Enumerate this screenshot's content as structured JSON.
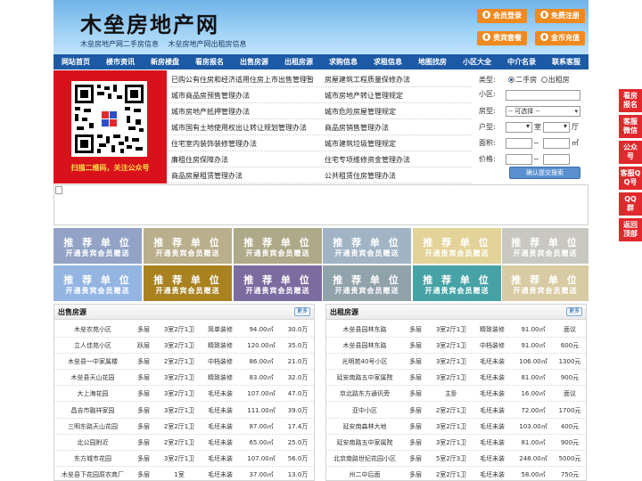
{
  "header": {
    "logo": "木垒房地产网",
    "sub1": "木垒房地产网二手房信息",
    "sub2": "木垒房地产网出租房信息",
    "buttons": [
      "会员登录",
      "免费注册",
      "贵宾套餐",
      "金币充值"
    ]
  },
  "nav": [
    "网站首页",
    "楼市资讯",
    "新房楼盘",
    "看房报名",
    "出售房源",
    "出租房源",
    "求购信息",
    "求租信息",
    "地图找房",
    "小区大全",
    "中介名录",
    "联系客服"
  ],
  "qr": {
    "caption": "扫描二维码，关注公众号"
  },
  "links": {
    "left": [
      "已购公有住房和经济适用住房上市出售管理暂",
      "城市商品房预售管理办法",
      "城市房地产抵押管理办法",
      "城市国有土地使用权出让转让规划管理办法",
      "住宅室内装饰装修管理办法",
      "廉租住房保障办法",
      "商品房屋租赁管理办法"
    ],
    "right": [
      "房屋建筑工程质量保修办法",
      "城市房地产转让管理规定",
      "城市危险房屋管理规定",
      "商品房销售管理办法",
      "城市建筑垃圾管理规定",
      "住宅专项维修资金管理办法",
      "公共租赁住房管理办法"
    ]
  },
  "search": {
    "type_label": "类型:",
    "opt1": "二手房",
    "opt2": "出租房",
    "community_label": "小区:",
    "type2_label": "房型:",
    "select_placeholder": "-- 可选择 --",
    "layout_label": "户型:",
    "room": "室",
    "hall": "厅",
    "area_label": "面积:",
    "area_unit": "㎡",
    "price_label": "价格:",
    "tilde": "~",
    "submit": "确认提交搜索"
  },
  "ads": {
    "title": "推 荐 单 位",
    "sub": "开通贵宾会员赠送",
    "colors": [
      "#8e9fc4",
      "#b6ab86",
      "#aaa582",
      "#9db1c4",
      "#e2d194",
      "#c7c5be",
      "#8fb2e0",
      "#a57b14",
      "#75649a",
      "#8b9ea6",
      "#3d9ea1",
      "#d6c9a0"
    ]
  },
  "sale": {
    "title": "出售房源",
    "more": "更多",
    "rows": [
      [
        "木垒农苑小区",
        "多层",
        "3室2厅1卫",
        "简单装修",
        "94.00㎡",
        "30.0万"
      ],
      [
        "立人佳苑小区",
        "跃层",
        "3室2厅1卫",
        "精致装修",
        "120.00㎡",
        "35.0万"
      ],
      [
        "木垒县一中家属楼",
        "多层",
        "2室2厅1卫",
        "中档装修",
        "86.00㎡",
        "21.0万"
      ],
      [
        "木垒县天山花园",
        "多层",
        "3室2厅1卫",
        "精致装修",
        "83.00㎡",
        "32.0万"
      ],
      [
        "大上海花园",
        "多层",
        "3室2厅1卫",
        "毛坯未装",
        "107.00㎡",
        "47.0万"
      ],
      [
        "昌吉市融祥家园",
        "多层",
        "3室2厅1卫",
        "毛坯未装",
        "111.00㎡",
        "39.0万"
      ],
      [
        "三明东路天山花园",
        "多层",
        "2室2厅1卫",
        "毛坯未装",
        "87.00㎡",
        "17.4万"
      ],
      [
        "北公园附近",
        "多层",
        "2室2厅1卫",
        "毛坯未装",
        "65.00㎡",
        "25.0万"
      ],
      [
        "东方城市花园",
        "多层",
        "3室2厅1卫",
        "毛坯未装",
        "107.00㎡",
        "56.0万"
      ],
      [
        "木垒县下花园原农商厂",
        "多层",
        "1室",
        "毛坯未装",
        "37.00㎡",
        "13.0万"
      ]
    ]
  },
  "rent": {
    "title": "出租房源",
    "more": "更多",
    "rows": [
      [
        "木垒县园林东路",
        "多层",
        "3室2厅1卫",
        "精致装修",
        "91.00㎡",
        "面议"
      ],
      [
        "木垒县园林东路",
        "多层",
        "3室2厅1卫",
        "中档装修",
        "91.00㎡",
        "600元"
      ],
      [
        "光明苑40号小区",
        "多层",
        "3室2厅1卫",
        "毛坯未装",
        "106.00㎡",
        "1300元"
      ],
      [
        "延安南路五中家属院",
        "多层",
        "3室2厅1卫",
        "毛坯未装",
        "81.00㎡",
        "900元"
      ],
      [
        "京北路东方通讯旁",
        "多层",
        "主卧",
        "毛坯未装",
        "16.00㎡",
        "面议"
      ],
      [
        "亚中小区",
        "多层",
        "2室2厅1卫",
        "毛坯未装",
        "72.00㎡",
        "1700元"
      ],
      [
        "延安南森林大地",
        "多层",
        "3室2厅1卫",
        "毛坯未装",
        "103.00㎡",
        "400元"
      ],
      [
        "延安南路五中家属院",
        "多层",
        "3室2厅1卫",
        "毛坯未装",
        "81.00㎡",
        "900元"
      ],
      [
        "北京南路世纪花园小区",
        "多层",
        "5室2厅3卫",
        "毛坯未装",
        "248.00㎡",
        "5000元"
      ],
      [
        "州二中后面",
        "多层",
        "2室2厅1卫",
        "毛坯未装",
        "58.00㎡",
        "750元"
      ]
    ]
  },
  "float": [
    "看房报名",
    "客服微信",
    "公众号",
    "客服QQ号",
    "QQ群",
    "返回顶部"
  ]
}
